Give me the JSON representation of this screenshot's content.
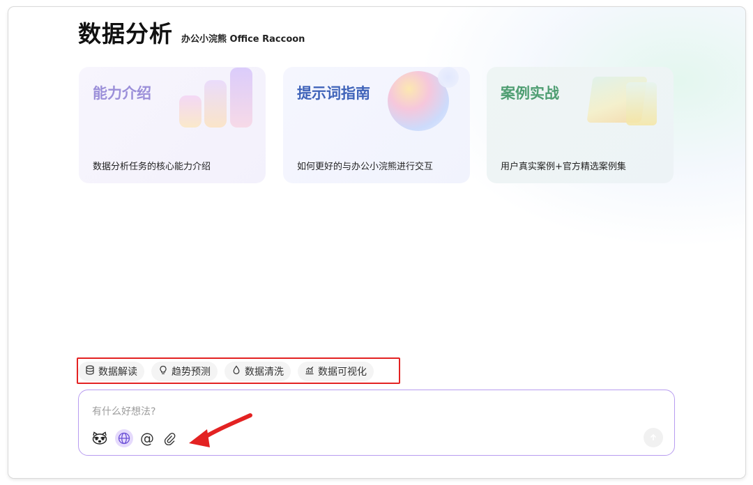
{
  "header": {
    "title": "数据分析",
    "subtitle": "办公小浣熊 Office Raccoon"
  },
  "cards": [
    {
      "title": "能力介绍",
      "description": "数据分析任务的核心能力介绍"
    },
    {
      "title": "提示词指南",
      "description": "如何更好的与办公小浣熊进行交互"
    },
    {
      "title": "案例实战",
      "description": "用户真实案例+官方精选案例集"
    }
  ],
  "chips": [
    {
      "label": "数据解读",
      "icon": "database-icon"
    },
    {
      "label": "趋势预测",
      "icon": "lightbulb-icon"
    },
    {
      "label": "数据清洗",
      "icon": "droplet-icon"
    },
    {
      "label": "数据可视化",
      "icon": "chart-icon"
    }
  ],
  "composer": {
    "placeholder": "有什么好想法?",
    "at_symbol": "@",
    "tools": [
      "raccoon-icon",
      "globe-icon",
      "at-icon",
      "paperclip-icon"
    ]
  },
  "colors": {
    "accent": "#b89cf0",
    "annotation": "#e32222",
    "card1_title": "#9b8fd9",
    "card2_title": "#3f63b9",
    "card3_title": "#4f9e72"
  }
}
